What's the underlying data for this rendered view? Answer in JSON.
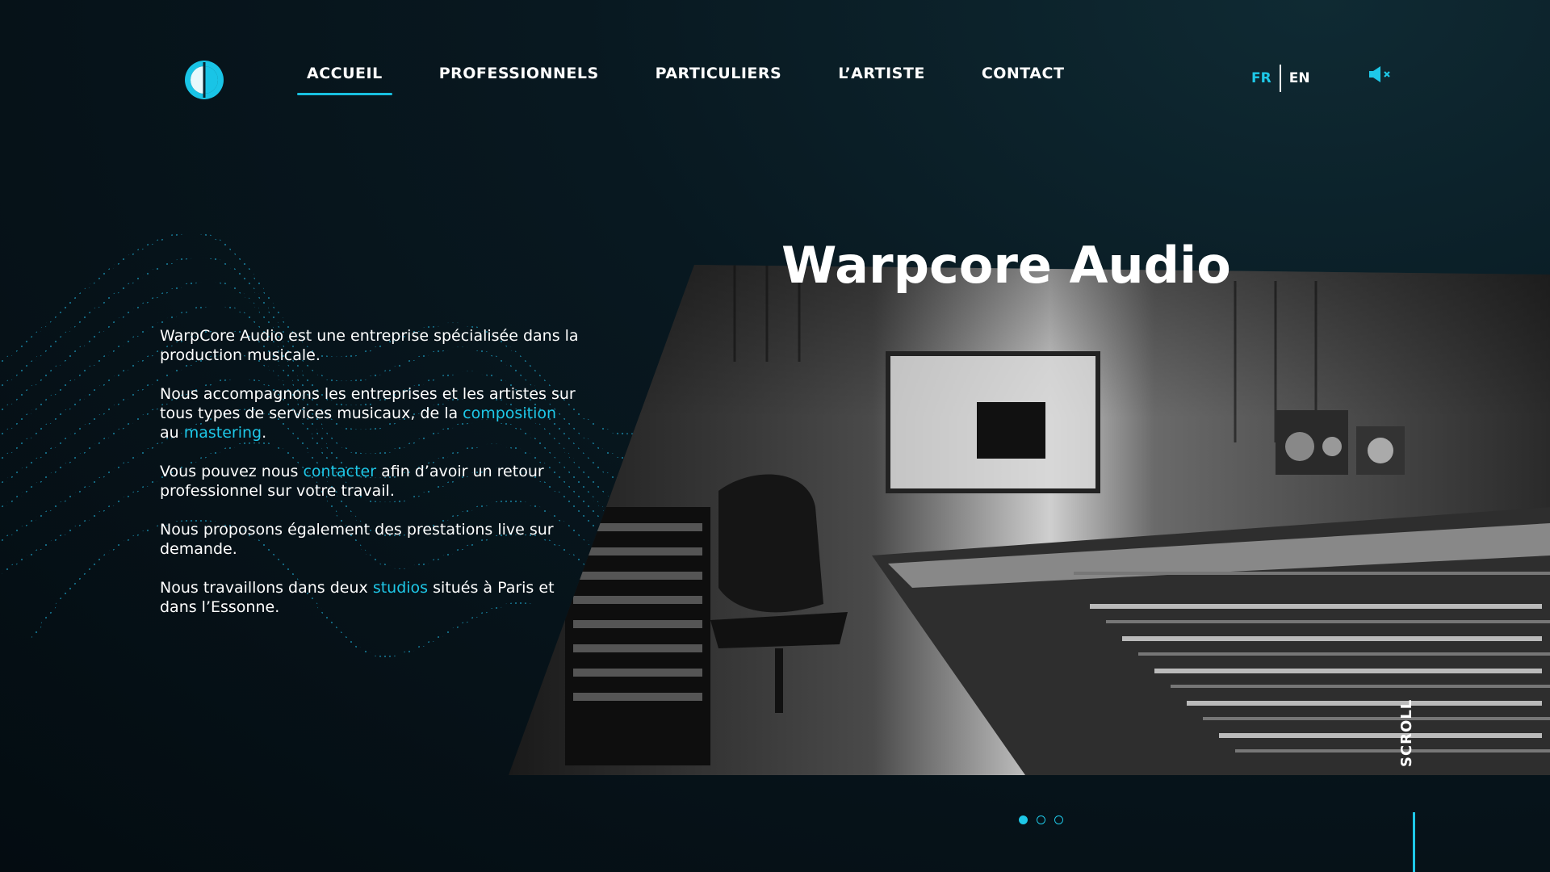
{
  "header": {
    "nav": [
      {
        "label": "ACCUEIL",
        "active": true
      },
      {
        "label": "PROFESSIONNELS",
        "active": false
      },
      {
        "label": "PARTICULIERS",
        "active": false
      },
      {
        "label": "L’ARTISTE",
        "active": false
      },
      {
        "label": "CONTACT",
        "active": false
      }
    ],
    "lang": {
      "fr": "FR",
      "en": "EN",
      "active": "FR"
    },
    "sound_icon": "speaker-muted-icon",
    "logo_icon": "warpcore-logo-icon"
  },
  "hero": {
    "title": "Warpcore Audio",
    "image": "studio-control-room-photo",
    "paragraphs": {
      "p1": "WarpCore Audio est une entreprise spécialisée dans la production musicale.",
      "p2_a": "Nous accompagnons les entreprises et les artistes sur tous types de services musicaux, de la ",
      "p2_link1": "composition",
      "p2_b": " au ",
      "p2_link2": "mastering",
      "p2_c": ".",
      "p3_a": "Vous pouvez nous ",
      "p3_link": "contacter",
      "p3_b": " afin d’avoir un retour professionnel sur votre travail.",
      "p4": "Nous proposons également des prestations live sur demande.",
      "p5_a": "Nous travaillons dans deux ",
      "p5_link": "studios",
      "p5_b": " situés à Paris et dans l’Essonne."
    }
  },
  "carousel": {
    "count": 3,
    "active_index": 0
  },
  "scroll_label": "SCROLL",
  "colors": {
    "accent": "#1ec8e8",
    "background": "#06131a",
    "text": "#ffffff"
  }
}
